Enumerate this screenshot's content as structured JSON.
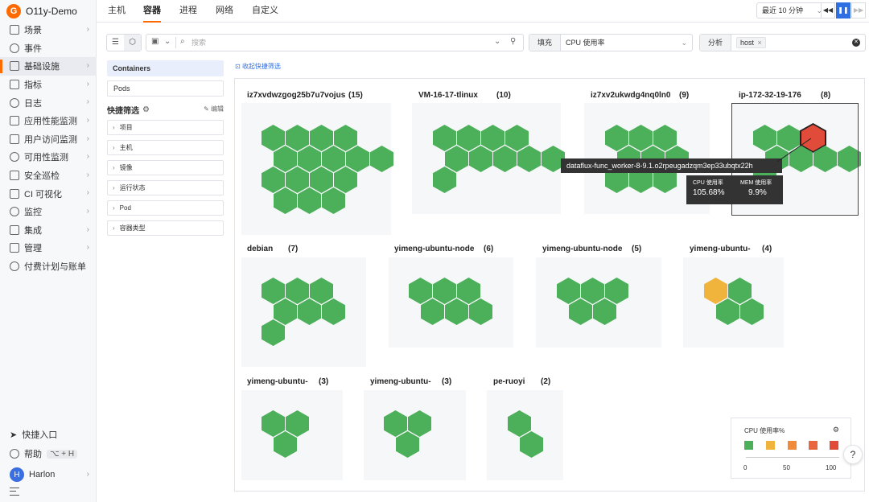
{
  "app": {
    "name": "O11y-Demo"
  },
  "sidebar": {
    "items": [
      {
        "label": "场景",
        "chevron": true
      },
      {
        "label": "事件",
        "chevron": false
      },
      {
        "label": "基础设施",
        "chevron": true,
        "active": true
      },
      {
        "label": "指标",
        "chevron": true
      },
      {
        "label": "日志",
        "chevron": true
      },
      {
        "label": "应用性能监测",
        "chevron": true
      },
      {
        "label": "用户访问监测",
        "chevron": true
      },
      {
        "label": "可用性监测",
        "chevron": true
      },
      {
        "label": "安全巡检",
        "chevron": true
      },
      {
        "label": "CI 可视化",
        "chevron": true
      },
      {
        "label": "监控",
        "chevron": true
      },
      {
        "label": "集成",
        "chevron": true
      },
      {
        "label": "管理",
        "chevron": true
      },
      {
        "label": "付费计划与账单",
        "chevron": false
      }
    ],
    "bottom": {
      "quick_entry": "快捷入口",
      "help": "帮助",
      "help_shortcut": "⌥ + H",
      "user_initial": "H",
      "user_name": "Harlon"
    }
  },
  "topbar": {
    "tabs": [
      "主机",
      "容器",
      "进程",
      "网络",
      "自定义"
    ],
    "active_tab": 1,
    "time_range": "最近 10 分钟",
    "controls": [
      "◀◀",
      "❚❚",
      "▶▶"
    ]
  },
  "toolbar": {
    "search_placeholder": "搜索",
    "fill_label": "填充",
    "fill_value": "CPU 使用率",
    "analysis_label": "分析",
    "analysis_tag": "host",
    "analysis_tag_close": "×"
  },
  "filters": {
    "header": "Containers",
    "pods": "Pods",
    "quick_title": "快捷筛选",
    "edit": "编辑",
    "facets": [
      "项目",
      "主机",
      "镜像",
      "运行状态",
      "Pod",
      "容器类型"
    ],
    "collapse": "收起快捷筛选"
  },
  "colors": {
    "green": "#4caf5a",
    "yellow": "#f0b43c",
    "orange": "#ef8b3a",
    "red_orange": "#e8673f",
    "red": "#e04b3a",
    "accent": "#ff6a00",
    "primary": "#2f6fe4"
  },
  "groups": [
    {
      "name": "iz7xvdwzgog25b7u7vojus",
      "count": "(15)"
    },
    {
      "name": "VM-16-17-tlinux",
      "count": "(10)"
    },
    {
      "name": "iz7xv2ukwdg4nq0ln0",
      "count": "(9)"
    },
    {
      "name": "ip-172-32-19-176",
      "count": "(8)"
    },
    {
      "name": "debian",
      "count": "(7)"
    },
    {
      "name": "yimeng-ubuntu-node",
      "count": "(6)"
    },
    {
      "name": "yimeng-ubuntu-node",
      "count": "(5)"
    },
    {
      "name": "yimeng-ubuntu-",
      "count": "(4)"
    },
    {
      "name": "yimeng-ubuntu-",
      "count": "(3)"
    },
    {
      "name": "yimeng-ubuntu-",
      "count": "(3)"
    },
    {
      "name": "pe-ruoyi",
      "count": "(2)"
    }
  ],
  "tooltip": {
    "name": "dataflux-func_worker-8-9.1.o2rpeugadzqm3ep33ubqtx22h",
    "cpu_label": "CPU 使用率",
    "cpu_value": "105.68%",
    "mem_label": "MEM 使用率",
    "mem_value": "9.9%"
  },
  "legend": {
    "title": "CPU 使用率%",
    "ticks": [
      "0",
      "50",
      "100"
    ]
  }
}
